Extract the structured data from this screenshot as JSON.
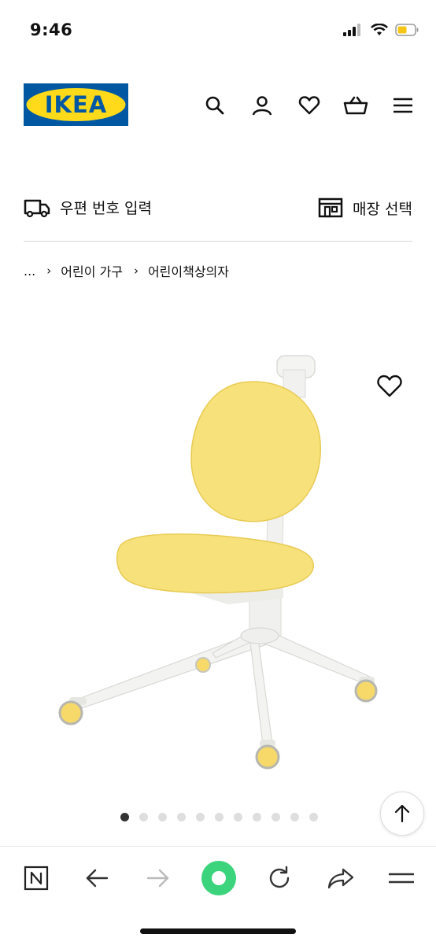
{
  "status_bar": {
    "time": "9:46",
    "battery_color": "#f5c518"
  },
  "header": {
    "logo_text": "IKEA",
    "brand_colors": {
      "blue": "#0058a3",
      "yellow": "#ffda1a"
    },
    "icons": [
      "search-icon",
      "account-icon",
      "heart-icon",
      "cart-icon",
      "menu-icon"
    ]
  },
  "delivery": {
    "postal_label": "우편 번호 입력",
    "store_label": "매장 선택"
  },
  "breadcrumb": {
    "ellipsis": "...",
    "items": [
      "어린이 가구",
      "어린이책상의자"
    ]
  },
  "product": {
    "image_name": "yellow-childrens-desk-chair",
    "chair_color": "#f7e17a",
    "carousel_total": 11,
    "carousel_active": 1
  },
  "toolbar": {
    "icons": [
      "n-icon",
      "back-arrow-icon",
      "forward-arrow-icon",
      "home-circle-icon",
      "reload-icon",
      "share-icon",
      "menu-lines-icon"
    ],
    "accent": "#3bd47c"
  }
}
